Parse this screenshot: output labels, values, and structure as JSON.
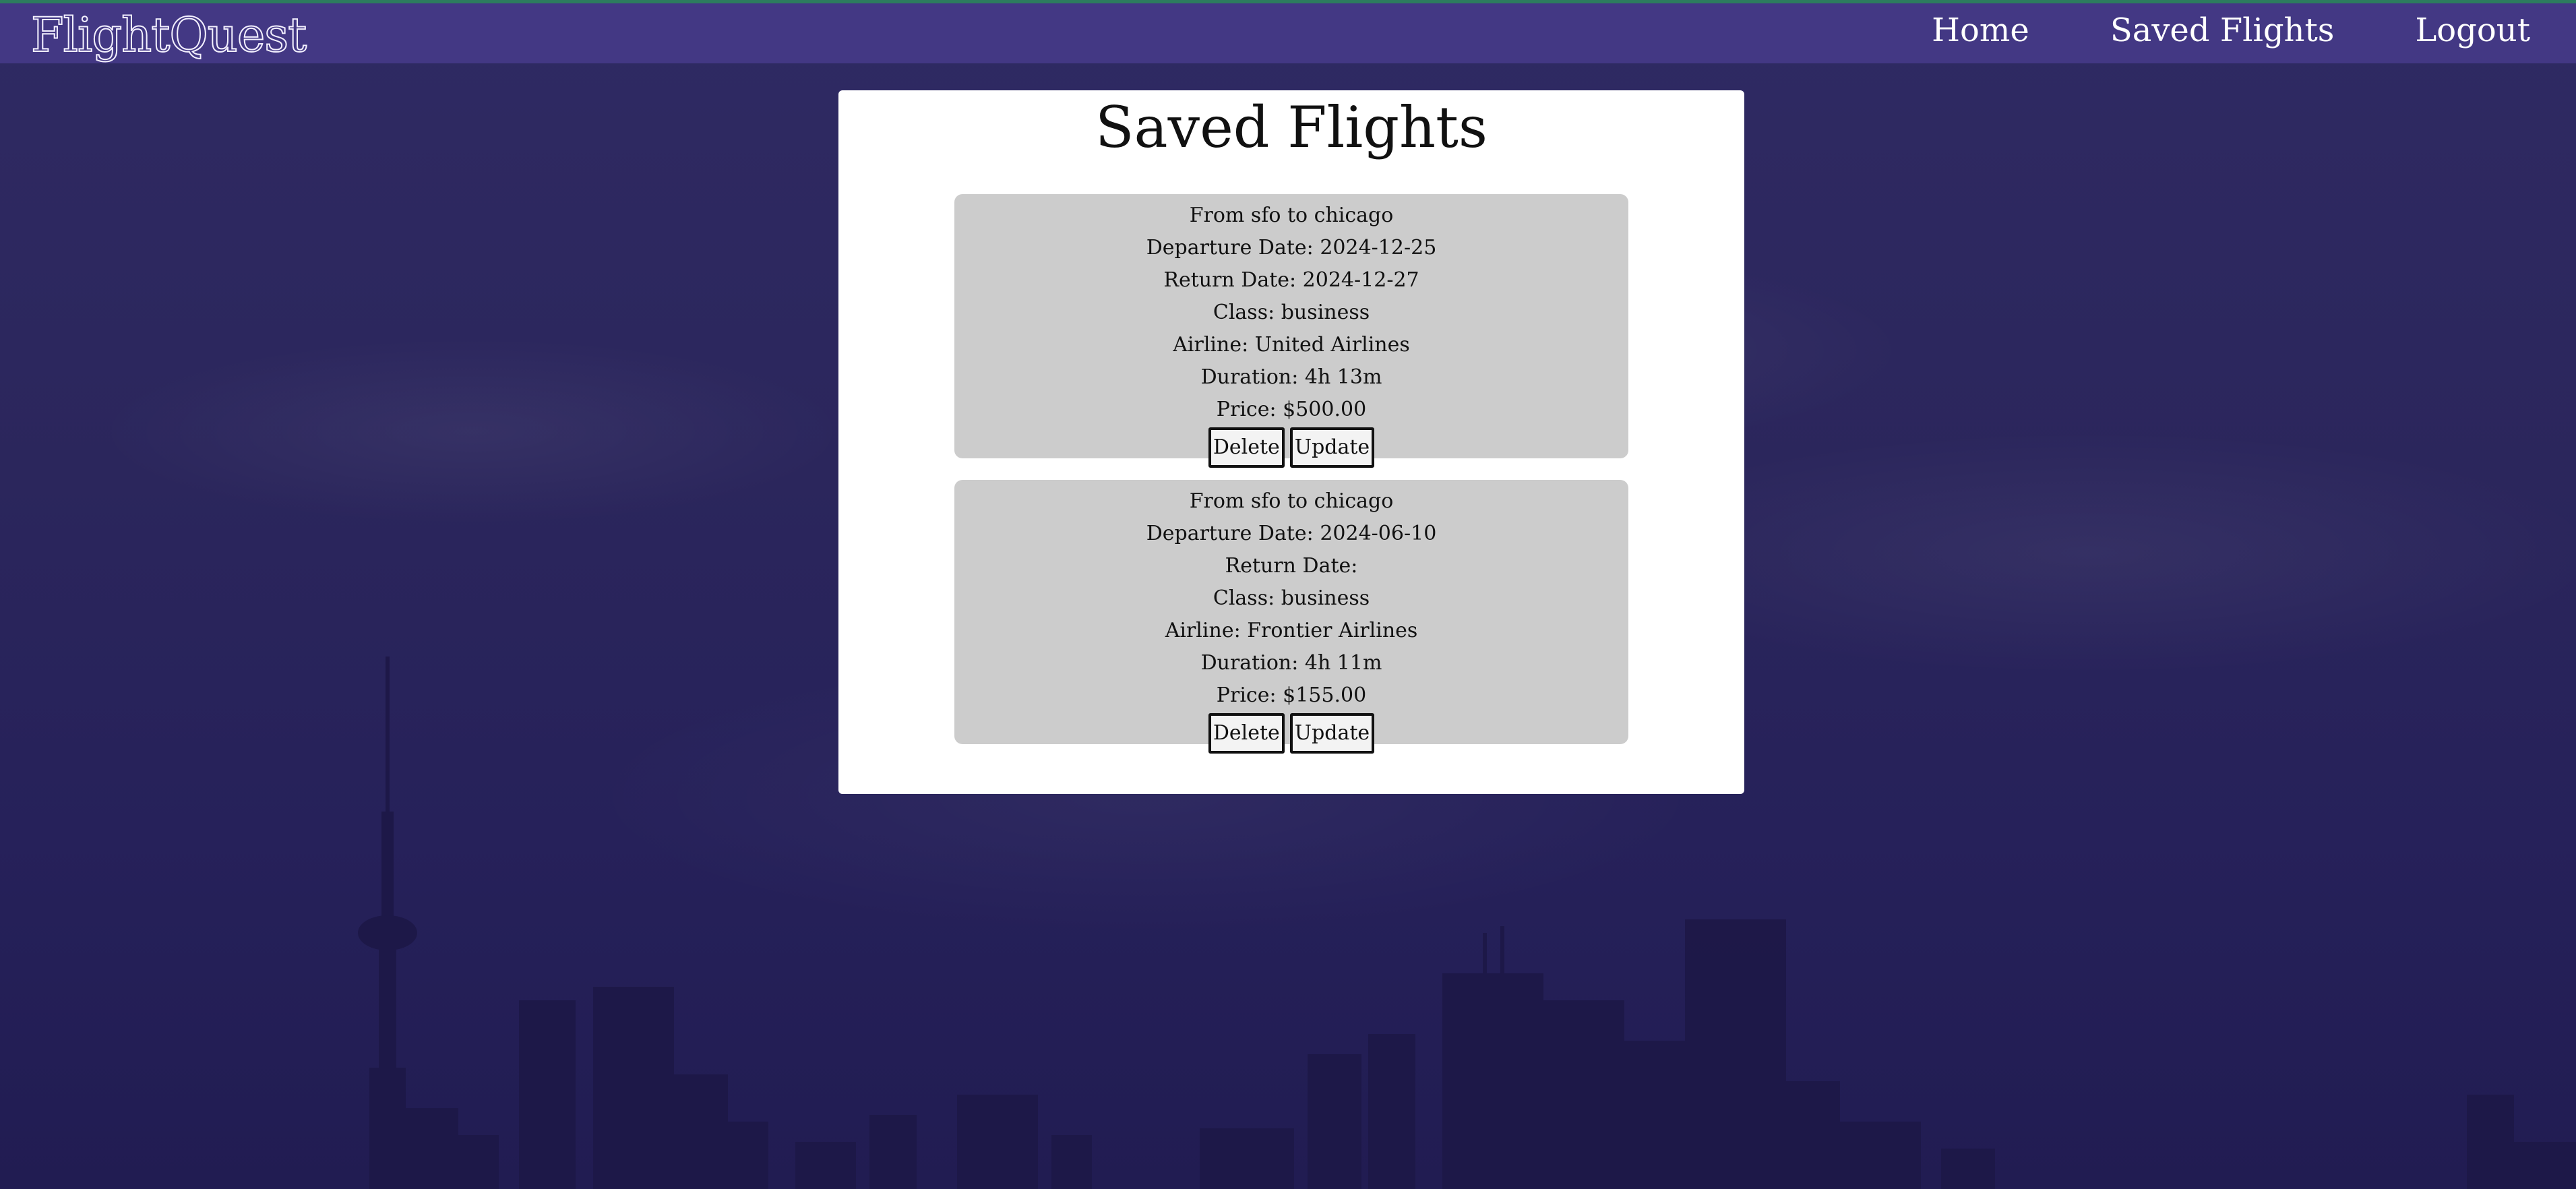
{
  "brand": "FlightQuest",
  "nav": {
    "home": "Home",
    "saved_flights": "Saved Flights",
    "logout": "Logout"
  },
  "page_title": "Saved Flights",
  "flights": [
    {
      "route": "From sfo to chicago",
      "departure": "Departure Date: 2024-12-25",
      "return": "Return Date: 2024-12-27",
      "class": "Class: business",
      "airline": "Airline: United Airlines",
      "duration": "Duration: 4h 13m",
      "price": "Price: $500.00",
      "delete_label": "Delete",
      "update_label": "Update"
    },
    {
      "route": "From sfo to chicago",
      "departure": "Departure Date: 2024-06-10",
      "return": "Return Date:",
      "class": "Class: business",
      "airline": "Airline: Frontier Airlines",
      "duration": "Duration: 4h 11m",
      "price": "Price: $155.00",
      "delete_label": "Delete",
      "update_label": "Update"
    }
  ],
  "colors": {
    "navbar": "#433884",
    "background": "#2b265c",
    "card": "#cccccc",
    "panel": "#ffffff"
  }
}
